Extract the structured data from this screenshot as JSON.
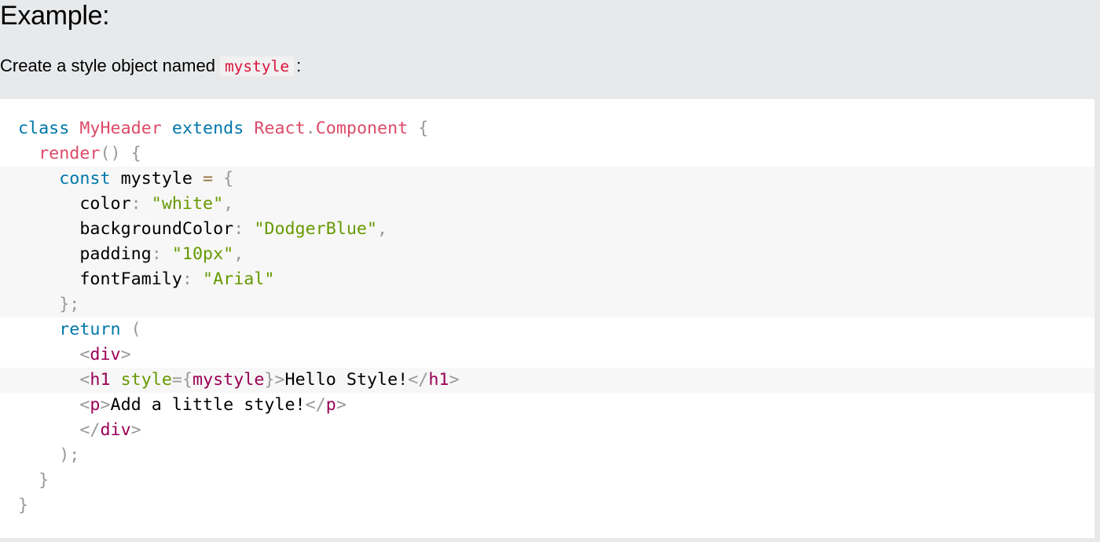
{
  "page": {
    "heading": "Example:",
    "intro_text": "Create a style object named",
    "intro_code": "mystyle",
    "intro_suffix": ":"
  },
  "colors": {
    "page_background": "#e7e9eb",
    "code_background": "#ffffff",
    "highlight_background": "#f7f7f7",
    "keyword": "#0077aa",
    "class_name": "#dd4a68",
    "string": "#669900",
    "tag": "#990055",
    "punctuation": "#999999",
    "inline_code": "#dc143c"
  },
  "code": {
    "lines": [
      {
        "indent": "",
        "tokens": [
          [
            "kw",
            "class"
          ],
          [
            "tx",
            " "
          ],
          [
            "cl",
            "MyHeader"
          ],
          [
            "tx",
            " "
          ],
          [
            "kw",
            "extends"
          ],
          [
            "tx",
            " "
          ],
          [
            "cl",
            "React"
          ],
          [
            "pn",
            "."
          ],
          [
            "cl",
            "Component"
          ],
          [
            "tx",
            " "
          ],
          [
            "pn",
            "{"
          ]
        ]
      },
      {
        "indent": "  ",
        "tokens": [
          [
            "fn",
            "render"
          ],
          [
            "pn",
            "()"
          ],
          [
            "tx",
            " "
          ],
          [
            "pn",
            "{"
          ]
        ]
      },
      {
        "indent": "    ",
        "highlight": true,
        "tokens": [
          [
            "kw",
            "const"
          ],
          [
            "tx",
            " mystyle "
          ],
          [
            "op",
            "="
          ],
          [
            "tx",
            " "
          ],
          [
            "pn",
            "{"
          ]
        ]
      },
      {
        "indent": "      ",
        "highlight": true,
        "tokens": [
          [
            "tx",
            "color"
          ],
          [
            "pn",
            ":"
          ],
          [
            "tx",
            " "
          ],
          [
            "st",
            "\"white\""
          ],
          [
            "pn",
            ","
          ]
        ]
      },
      {
        "indent": "      ",
        "highlight": true,
        "tokens": [
          [
            "tx",
            "backgroundColor"
          ],
          [
            "pn",
            ":"
          ],
          [
            "tx",
            " "
          ],
          [
            "st",
            "\"DodgerBlue\""
          ],
          [
            "pn",
            ","
          ]
        ]
      },
      {
        "indent": "      ",
        "highlight": true,
        "tokens": [
          [
            "tx",
            "padding"
          ],
          [
            "pn",
            ":"
          ],
          [
            "tx",
            " "
          ],
          [
            "st",
            "\"10px\""
          ],
          [
            "pn",
            ","
          ]
        ]
      },
      {
        "indent": "      ",
        "highlight": true,
        "tokens": [
          [
            "tx",
            "fontFamily"
          ],
          [
            "pn",
            ":"
          ],
          [
            "tx",
            " "
          ],
          [
            "st",
            "\"Arial\""
          ]
        ]
      },
      {
        "indent": "    ",
        "highlight": true,
        "tokens": [
          [
            "pn",
            "};"
          ]
        ]
      },
      {
        "indent": "    ",
        "tokens": [
          [
            "kw",
            "return"
          ],
          [
            "tx",
            " "
          ],
          [
            "pn",
            "("
          ]
        ]
      },
      {
        "indent": "      ",
        "tokens": [
          [
            "pn",
            "<"
          ],
          [
            "tg",
            "div"
          ],
          [
            "pn",
            ">"
          ]
        ]
      },
      {
        "indent": "      ",
        "highlight": true,
        "tokens": [
          [
            "pn",
            "<"
          ],
          [
            "tg",
            "h1"
          ],
          [
            "tx",
            " "
          ],
          [
            "at",
            "style"
          ],
          [
            "pn",
            "={"
          ],
          [
            "tg",
            "mystyle"
          ],
          [
            "pn",
            "}>"
          ],
          [
            "tx",
            "Hello Style!"
          ],
          [
            "pn",
            "</"
          ],
          [
            "tg",
            "h1"
          ],
          [
            "pn",
            ">"
          ]
        ]
      },
      {
        "indent": "      ",
        "tokens": [
          [
            "pn",
            "<"
          ],
          [
            "tg",
            "p"
          ],
          [
            "pn",
            ">"
          ],
          [
            "tx",
            "Add a little style!"
          ],
          [
            "pn",
            "</"
          ],
          [
            "tg",
            "p"
          ],
          [
            "pn",
            ">"
          ]
        ]
      },
      {
        "indent": "      ",
        "tokens": [
          [
            "pn",
            "</"
          ],
          [
            "tg",
            "div"
          ],
          [
            "pn",
            ">"
          ]
        ]
      },
      {
        "indent": "    ",
        "tokens": [
          [
            "pn",
            ");"
          ]
        ]
      },
      {
        "indent": "  ",
        "tokens": [
          [
            "pn",
            "}"
          ]
        ]
      },
      {
        "indent": "",
        "tokens": [
          [
            "pn",
            "}"
          ]
        ]
      }
    ]
  }
}
